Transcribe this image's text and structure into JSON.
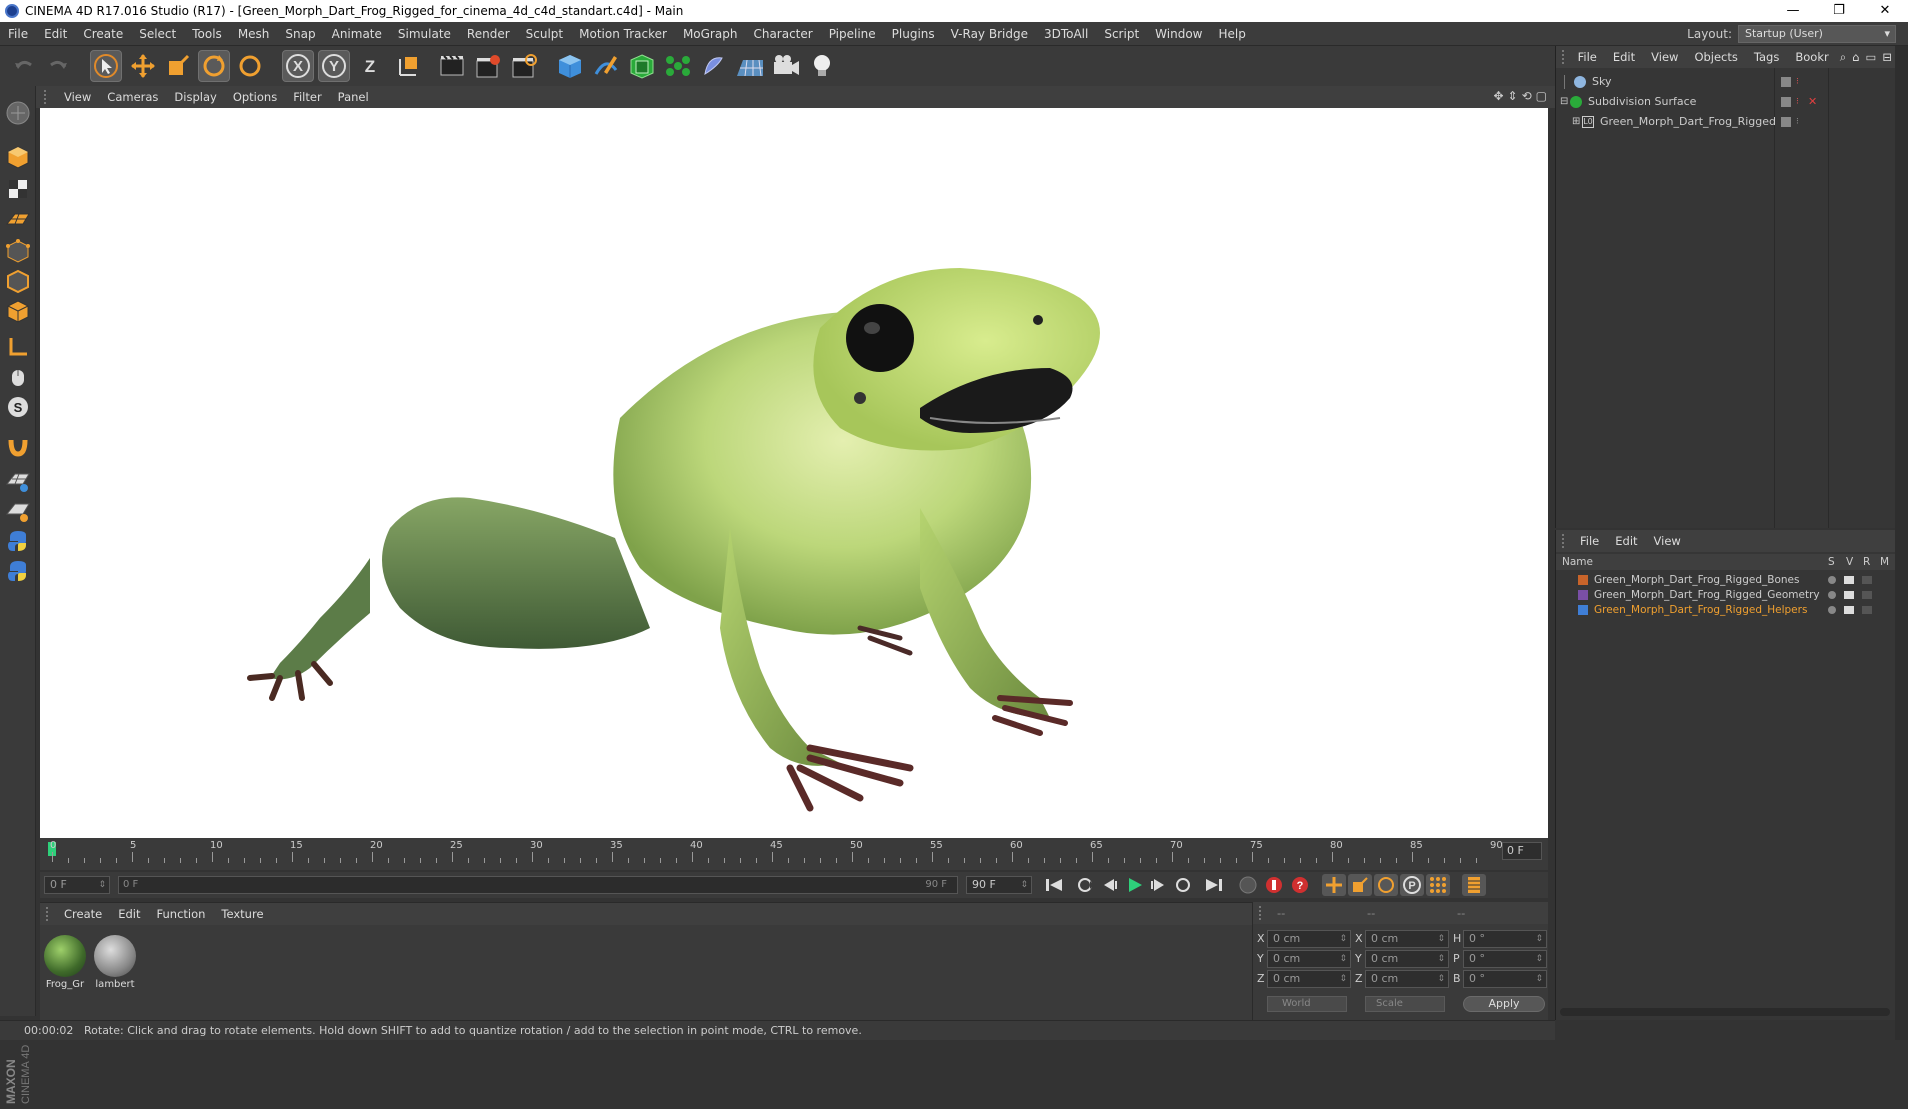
{
  "window": {
    "title": "CINEMA 4D R17.016 Studio (R17) - [Green_Morph_Dart_Frog_Rigged_for_cinema_4d_c4d_standart.c4d] - Main",
    "minimize": "—",
    "restore": "❐",
    "close": "✕"
  },
  "menubar": {
    "items": [
      "File",
      "Edit",
      "Create",
      "Select",
      "Tools",
      "Mesh",
      "Snap",
      "Animate",
      "Simulate",
      "Render",
      "Sculpt",
      "Motion Tracker",
      "MoGraph",
      "Character",
      "Pipeline",
      "Plugins",
      "V-Ray Bridge",
      "3DToAll",
      "Script",
      "Window",
      "Help"
    ],
    "layout_label": "Layout:",
    "layout_value": "Startup (User)"
  },
  "viewport": {
    "menu": [
      "View",
      "Cameras",
      "Display",
      "Options",
      "Filter",
      "Panel"
    ]
  },
  "timeline": {
    "ticks": [
      "0",
      "5",
      "10",
      "15",
      "20",
      "25",
      "30",
      "35",
      "40",
      "45",
      "50",
      "55",
      "60",
      "65",
      "70",
      "75",
      "80",
      "85",
      "90"
    ],
    "current_frame": "0 F"
  },
  "transport": {
    "start_field": "0 F",
    "range_start": "0 F",
    "range_end": "90 F",
    "end_field": "90 F"
  },
  "material_manager": {
    "menu": [
      "Create",
      "Edit",
      "Function",
      "Texture"
    ],
    "materials": [
      {
        "name": "Frog_Gr"
      },
      {
        "name": "lambert"
      }
    ]
  },
  "coordinates": {
    "headers": [
      "--",
      "--",
      "--"
    ],
    "rows": [
      {
        "a": "X",
        "a_val": "0 cm",
        "b": "X",
        "b_val": "0 cm",
        "c": "H",
        "c_val": "0 °"
      },
      {
        "a": "Y",
        "a_val": "0 cm",
        "b": "Y",
        "b_val": "0 cm",
        "c": "P",
        "c_val": "0 °"
      },
      {
        "a": "Z",
        "a_val": "0 cm",
        "b": "Z",
        "b_val": "0 cm",
        "c": "B",
        "c_val": "0 °"
      }
    ],
    "mode": "World",
    "scale": "Scale",
    "apply": "Apply"
  },
  "status": {
    "time": "00:00:02",
    "message": "Rotate: Click and drag to rotate elements. Hold down SHIFT to add to quantize rotation / add to the selection in point mode, CTRL to remove."
  },
  "object_manager": {
    "menu": [
      "File",
      "Edit",
      "View",
      "Objects",
      "Tags",
      "Bookr"
    ],
    "objects": [
      {
        "name": "Sky"
      },
      {
        "name": "Subdivision Surface"
      },
      {
        "name": "Green_Morph_Dart_Frog_Rigged"
      }
    ]
  },
  "layer_manager": {
    "menu": [
      "File",
      "Edit",
      "View"
    ],
    "col_name": "Name",
    "col_s": "S",
    "col_v": "V",
    "col_r": "R",
    "col_m": "M",
    "layers": [
      {
        "name": "Green_Morph_Dart_Frog_Rigged_Bones",
        "color": "#c8642a"
      },
      {
        "name": "Green_Morph_Dart_Frog_Rigged_Geometry",
        "color": "#7a4fa6"
      },
      {
        "name": "Green_Morph_Dart_Frog_Rigged_Helpers",
        "color": "#3f7ed6"
      }
    ]
  },
  "brand": {
    "text1": "MAXON",
    "text2": "CINEMA 4D"
  },
  "colors": {
    "accent": "#f09a2a",
    "selected_layer_text": "#f0a030"
  }
}
